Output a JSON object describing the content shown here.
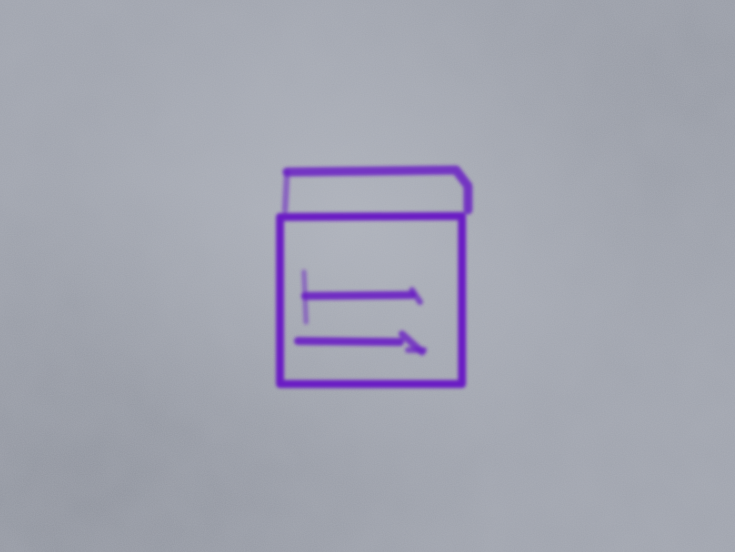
{
  "background": {
    "color": "#9ea2ac"
  },
  "icon": {
    "name": "calendar-icon",
    "stroke_color": "#6a1fc4"
  }
}
